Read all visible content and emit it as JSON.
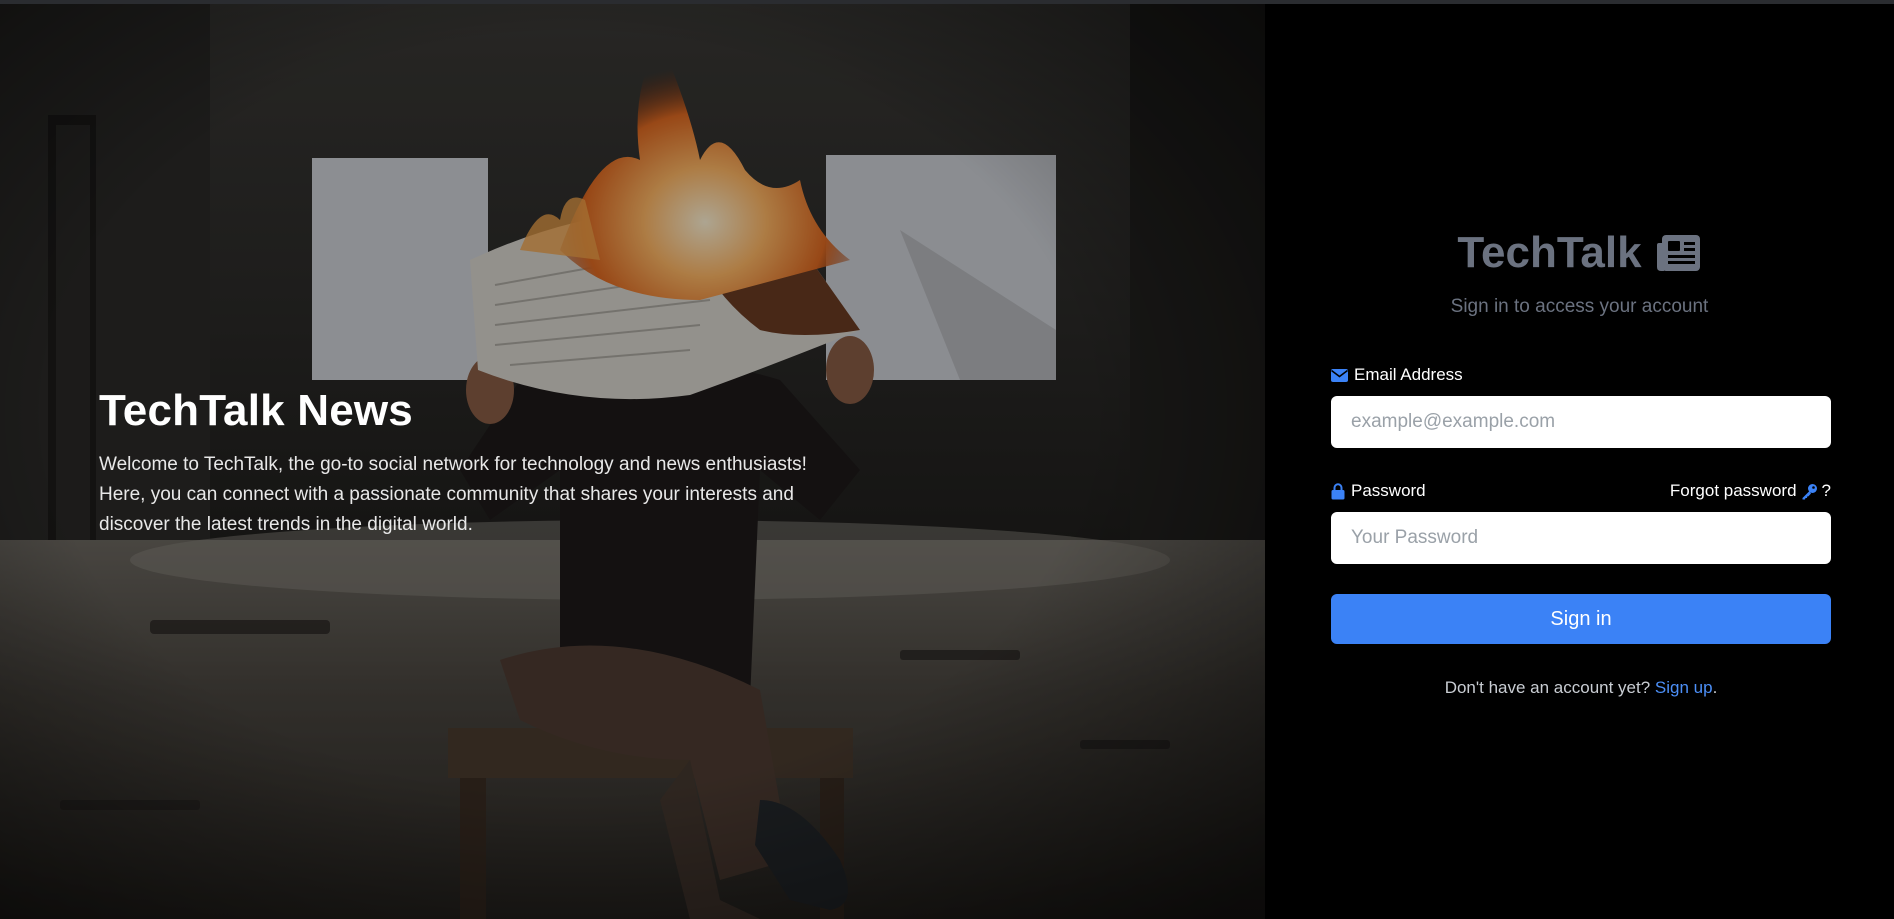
{
  "hero": {
    "title": "TechTalk News",
    "description": "Welcome to TechTalk, the go-to social network for technology and news enthusiasts! Here, you can connect with a passionate community that shares your interests and discover the latest trends in the digital world.",
    "image_icon": "burning-newspaper-photo"
  },
  "panel": {
    "brand": "TechTalk",
    "brand_icon": "newspaper-icon",
    "subtitle": "Sign in to access your account"
  },
  "form": {
    "email": {
      "icon": "envelope-icon",
      "label": "Email Address",
      "placeholder": "example@example.com",
      "value": ""
    },
    "password": {
      "icon": "lock-icon",
      "label": "Password",
      "placeholder": "Your Password",
      "value": ""
    },
    "forgot": {
      "label": "Forgot password",
      "icon": "key-icon",
      "suffix": "?"
    },
    "submit_label": "Sign in",
    "signup_prompt": "Don't have an account yet?",
    "signup_link": "Sign up",
    "signup_suffix": "."
  },
  "colors": {
    "accent": "#3b82f6",
    "link": "#4c8ff7",
    "brand_gray": "#6b7280",
    "icon_blue": "#3b82f6",
    "panel_bg": "#000000"
  }
}
